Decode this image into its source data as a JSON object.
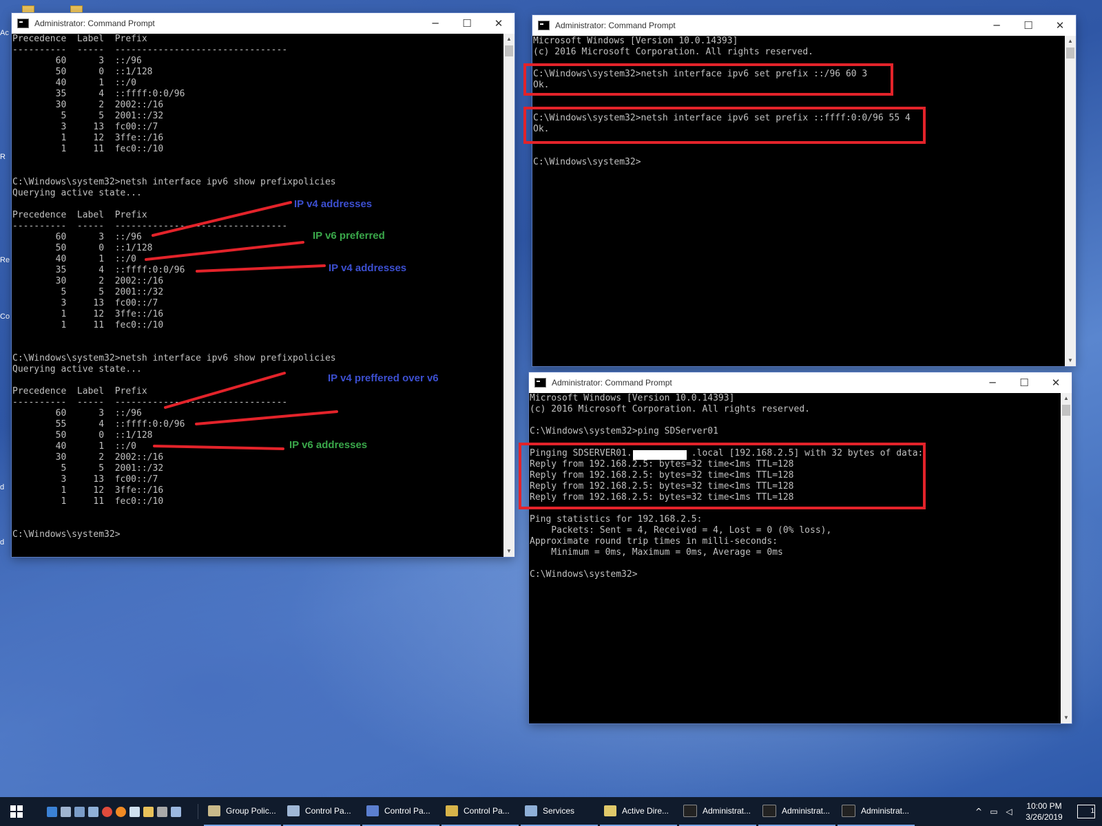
{
  "desktop": {
    "edge_labels": [
      "Ac",
      "R",
      "Re",
      "Co",
      "d",
      "d"
    ]
  },
  "windows": {
    "left": {
      "title": "Administrator: Command Prompt",
      "lines": [
        "Precedence  Label  Prefix",
        "----------  -----  --------------------------------",
        "        60      3  ::/96",
        "        50      0  ::1/128",
        "        40      1  ::/0",
        "        35      4  ::ffff:0:0/96",
        "        30      2  2002::/16",
        "         5      5  2001::/32",
        "         3     13  fc00::/7",
        "         1     12  3ffe::/16",
        "         1     11  fec0::/10",
        "",
        "",
        "C:\\Windows\\system32>netsh interface ipv6 show prefixpolicies",
        "Querying active state...",
        "",
        "Precedence  Label  Prefix",
        "----------  -----  --------------------------------",
        "        60      3  ::/96",
        "        50      0  ::1/128",
        "        40      1  ::/0",
        "        35      4  ::ffff:0:0/96",
        "        30      2  2002::/16",
        "         5      5  2001::/32",
        "         3     13  fc00::/7",
        "         1     12  3ffe::/16",
        "         1     11  fec0::/10",
        "",
        "",
        "C:\\Windows\\system32>netsh interface ipv6 show prefixpolicies",
        "Querying active state...",
        "",
        "Precedence  Label  Prefix",
        "----------  -----  --------------------------------",
        "        60      3  ::/96",
        "        55      4  ::ffff:0:0/96",
        "        50      0  ::1/128",
        "        40      1  ::/0",
        "        30      2  2002::/16",
        "         5      5  2001::/32",
        "         3     13  fc00::/7",
        "         1     12  3ffe::/16",
        "         1     11  fec0::/10",
        "",
        "",
        "C:\\Windows\\system32>"
      ]
    },
    "top_right": {
      "title": "Administrator: Command Prompt",
      "lines": [
        "Microsoft Windows [Version 10.0.14393]",
        "(c) 2016 Microsoft Corporation. All rights reserved.",
        "",
        "C:\\Windows\\system32>netsh interface ipv6 set prefix ::/96 60 3",
        "Ok.",
        "",
        "",
        "C:\\Windows\\system32>netsh interface ipv6 set prefix ::ffff:0:0/96 55 4",
        "Ok.",
        "",
        "",
        "C:\\Windows\\system32>"
      ]
    },
    "bottom_right": {
      "title": "Administrator: Command Prompt",
      "lines": [
        "Microsoft Windows [Version 10.0.14393]",
        "(c) 2016 Microsoft Corporation. All rights reserved.",
        "",
        "C:\\Windows\\system32>ping SDServer01",
        "",
        "Pinging SDSERVER01.           .local [192.168.2.5] with 32 bytes of data:",
        "Reply from 192.168.2.5: bytes=32 time<1ms TTL=128",
        "Reply from 192.168.2.5: bytes=32 time<1ms TTL=128",
        "Reply from 192.168.2.5: bytes=32 time<1ms TTL=128",
        "Reply from 192.168.2.5: bytes=32 time<1ms TTL=128",
        "",
        "Ping statistics for 192.168.2.5:",
        "    Packets: Sent = 4, Received = 4, Lost = 0 (0% loss),",
        "Approximate round trip times in milli-seconds:",
        "    Minimum = 0ms, Maximum = 0ms, Average = 0ms",
        "",
        "C:\\Windows\\system32>"
      ]
    }
  },
  "annotations": [
    {
      "text": "IP v4 addresses",
      "color": "blue"
    },
    {
      "text": "IP v6 preferred",
      "color": "green"
    },
    {
      "text": "IP v4 addresses",
      "color": "blue"
    },
    {
      "text": "IP v4 preffered over v6",
      "color": "blue"
    },
    {
      "text": "IP v6 addresses",
      "color": "green"
    }
  ],
  "taskbar": {
    "items": [
      {
        "label": "Group Polic...",
        "icon": "group-policy-icon",
        "color": "#c9b98a"
      },
      {
        "label": "Control Pa...",
        "icon": "control-panel-icon",
        "color": "#9fb7d6"
      },
      {
        "label": "Control Pa...",
        "icon": "control-panel-icon",
        "color": "#5b7fd0"
      },
      {
        "label": "Control Pa...",
        "icon": "control-panel-icon",
        "color": "#d7b44a"
      },
      {
        "label": "Services",
        "icon": "gear-icon",
        "color": "#8fb0d8"
      },
      {
        "label": "Active Dire...",
        "icon": "active-directory-icon",
        "color": "#e0c96a"
      },
      {
        "label": "Administrat...",
        "icon": "cmd-icon",
        "color": "#222222"
      },
      {
        "label": "Administrat...",
        "icon": "cmd-icon",
        "color": "#222222"
      },
      {
        "label": "Administrat...",
        "icon": "cmd-icon",
        "color": "#222222"
      }
    ],
    "time": "10:00 PM",
    "date": "3/26/2019",
    "notification_count": "1"
  }
}
